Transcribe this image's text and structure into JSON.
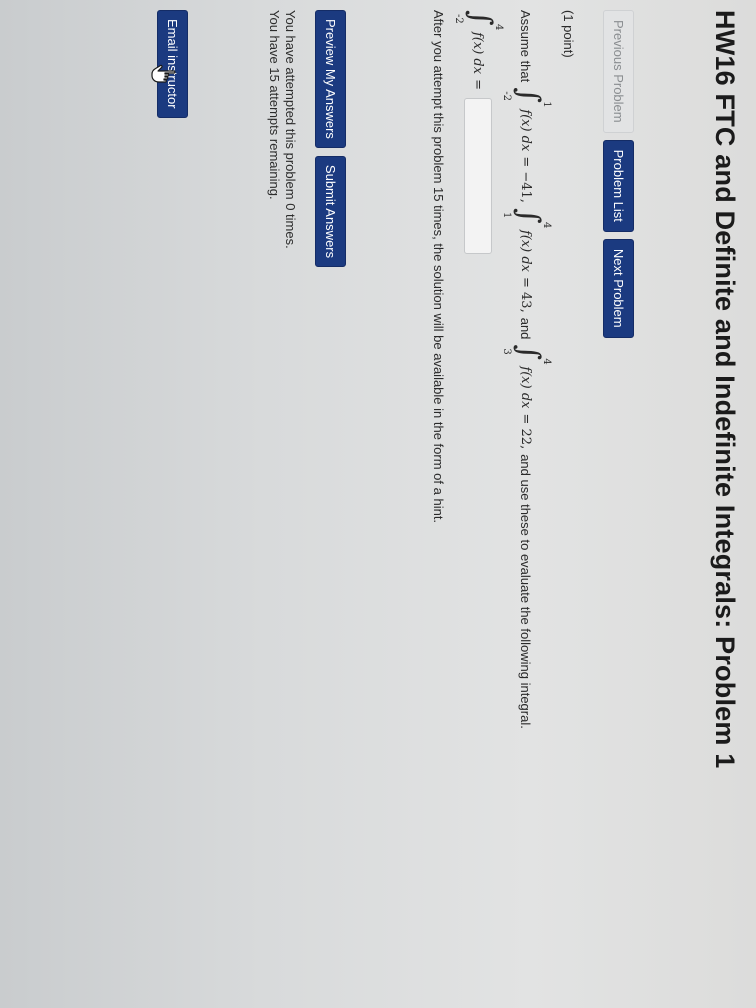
{
  "header": {
    "title": "HW16 FTC and Definite and Indefinite Integrals: Problem 1"
  },
  "nav": {
    "previous": "Previous Problem",
    "list": "Problem List",
    "next": "Next Problem"
  },
  "problem": {
    "points": "(1 point)",
    "assume": "Assume that",
    "integral1": {
      "upper": "1",
      "lower": "-2",
      "integrand": "f(x) dx",
      "rhs": "= −41,"
    },
    "integral2": {
      "upper": "4",
      "lower": "1",
      "integrand": "f(x) dx",
      "rhs": "= 43,"
    },
    "and_text": "and",
    "integral3": {
      "upper": "4",
      "lower": "3",
      "integrand": "f(x) dx",
      "rhs": "= 22,"
    },
    "tail": "and use these to evaluate the following integral.",
    "target": {
      "upper": "4",
      "lower": "-2",
      "integrand": "f(x) dx",
      "rhs": "="
    },
    "answer_value": "",
    "availability": "After you attempt this problem 15 times, the solution will be available in the form of a hint."
  },
  "actions": {
    "preview": "Preview My Answers",
    "submit": "Submit Answers"
  },
  "status": {
    "attempted": "You have attempted this problem 0 times.",
    "remaining": "You have 15 attempts remaining."
  },
  "email": {
    "label": "Email instructor"
  },
  "colors": {
    "primary_button": "#1b3a80",
    "disabled_button": "#e2e3e4"
  },
  "icons": {
    "cursor": "hand-pointer-icon"
  }
}
